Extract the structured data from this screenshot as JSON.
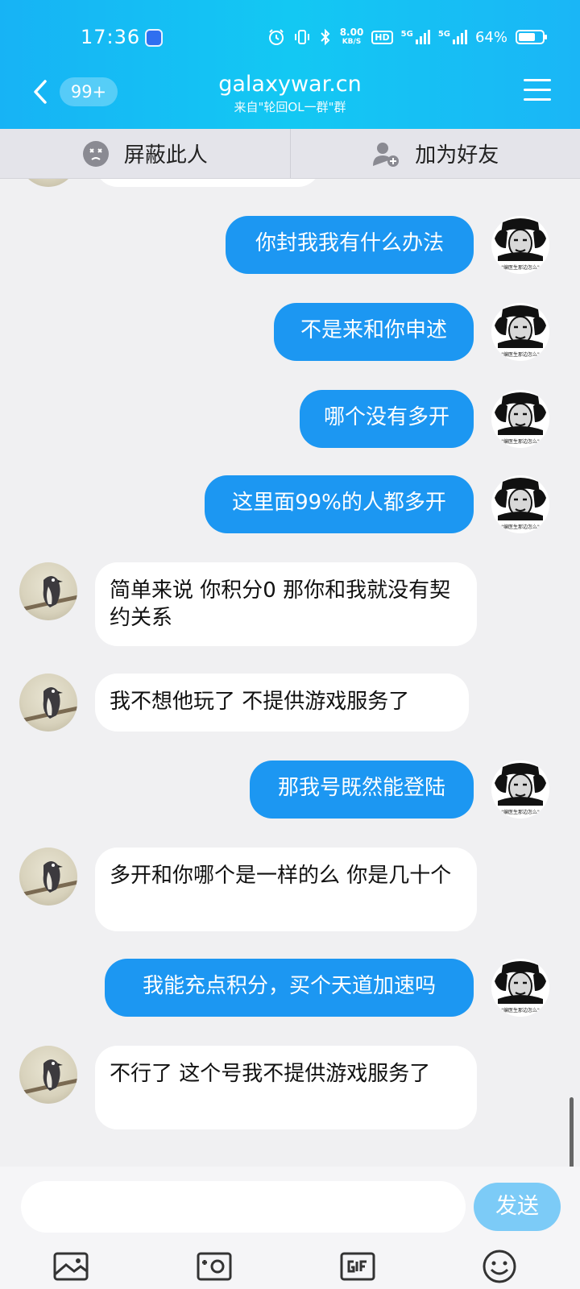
{
  "status_bar": {
    "time": "17:36",
    "net_speed_value": "8.00",
    "net_speed_unit": "KB/S",
    "hd_label": "HD",
    "sim1_label": "5G",
    "sim2_label": "5G",
    "battery_percent": "64%",
    "battery_level": 0.64
  },
  "header": {
    "unread_badge": "99+",
    "title": "galaxywar.cn",
    "subtitle": "来自\"轮回OL一群\"群"
  },
  "actions": {
    "block_label": "屏蔽此人",
    "add_friend_label": "加为好友"
  },
  "messages": [
    {
      "side": "out",
      "text": "你封我我有什么办法"
    },
    {
      "side": "out",
      "text": "不是来和你申述"
    },
    {
      "side": "out",
      "text": "哪个没有多开"
    },
    {
      "side": "out",
      "text": "这里面99%的人都多开"
    },
    {
      "side": "in",
      "text": "简单来说 你积分0  那你和我就没有契约关系"
    },
    {
      "side": "in",
      "text": "我不想他玩了 不提供游戏服务了"
    },
    {
      "side": "out",
      "text": "那我号既然能登陆"
    },
    {
      "side": "in",
      "text": "多开和你哪个是一样的么 你是几十个"
    },
    {
      "side": "out",
      "text": "我能充点积分，买个天道加速吗"
    },
    {
      "side": "in",
      "text": "不行了 这个号我不提供游戏服务了"
    }
  ],
  "avatar_caption": "\"编医生那边怎么\"",
  "composer": {
    "input_value": "",
    "send_label": "发送"
  },
  "colors": {
    "header": "#17b3f5",
    "outgoing_bubble": "#1c97f2",
    "send_button": "#7ccbf7"
  }
}
